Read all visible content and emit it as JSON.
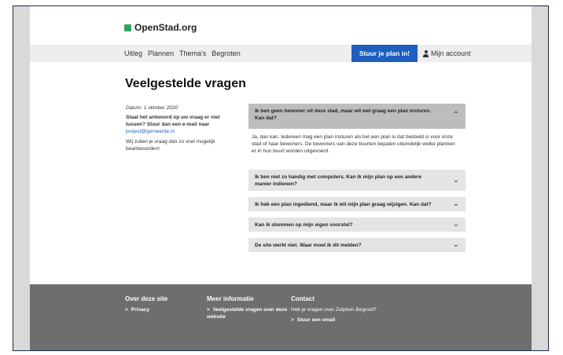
{
  "brand": {
    "name": "OpenStad.org"
  },
  "nav": {
    "links": [
      "Uitleg",
      "Plannen",
      "Thema's",
      "Begroten"
    ],
    "cta_label": "Stuur je plan in!",
    "account_label": "Mijn account"
  },
  "page": {
    "title": "Veelgestelde vragen"
  },
  "info": {
    "date": "Datum: 1 oktober 2020",
    "ask": "Staat het antwoord op uw vraag er niet tussen? Stuur dan een e-mail naar",
    "email": "project@gemeente.nl",
    "note": "Wij zullen je vraag dan zo snel mogelijk beantwoorden!"
  },
  "faq": {
    "items": [
      {
        "question": "Ik ben geen bewoner uit deze stad, maar wil wel graag een plan insturen. Kan dat?",
        "answer": "Ja, dan kan. Iedereen mag een plan insturen als het een plan is dat bedoeld is voor onze stad of haar bewoners. De bewoners van deze buurten bepalen uiteindelijk welke plannen er in hun buurt worden uitgevoerd.",
        "open": true
      },
      {
        "question": "Ik ben niet zo handig met computers. Kan ik mijn plan op een andere manier indienen?",
        "open": false
      },
      {
        "question": "Ik heb een plan ingediend, maar ik wil mijn plan graag wijzigen. Kan dat?",
        "open": false
      },
      {
        "question": "Kan ik stemmen op mijn eigen voorstel?",
        "open": false
      },
      {
        "question": "De site werkt niet. Waar moet ik dit melden?",
        "open": false
      }
    ]
  },
  "footer": {
    "col1": {
      "heading": "Over deze site",
      "link": "Privacy"
    },
    "col2": {
      "heading": "Meer informatie",
      "link": "Veelgestelde vragen over deze website"
    },
    "col3": {
      "heading": "Contact",
      "text": "Heb je vragen over Zutphen Begroot?",
      "link": "Stuur een email"
    }
  },
  "colors": {
    "accent": "#1f5fbf",
    "brand": "#2fa36b",
    "footer": "#6e6e6e"
  }
}
